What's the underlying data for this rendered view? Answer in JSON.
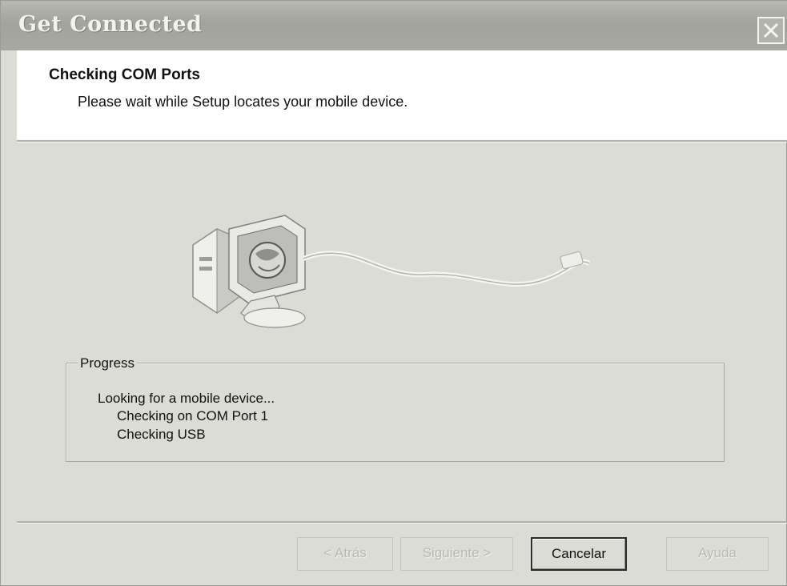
{
  "window": {
    "title": "Get Connected",
    "close_icon": "close-icon"
  },
  "header": {
    "title": "Checking COM Ports",
    "subtitle": "Please wait while Setup locates your mobile device."
  },
  "illustration": {
    "icon": "computer-connection-icon"
  },
  "progress": {
    "legend": "Progress",
    "lines": [
      "Looking for a mobile device...",
      "Checking on COM Port 1",
      "Checking USB"
    ]
  },
  "buttons": {
    "back": "< Atrás",
    "next": "Siguiente >",
    "cancel": "Cancelar",
    "help": "Ayuda"
  }
}
